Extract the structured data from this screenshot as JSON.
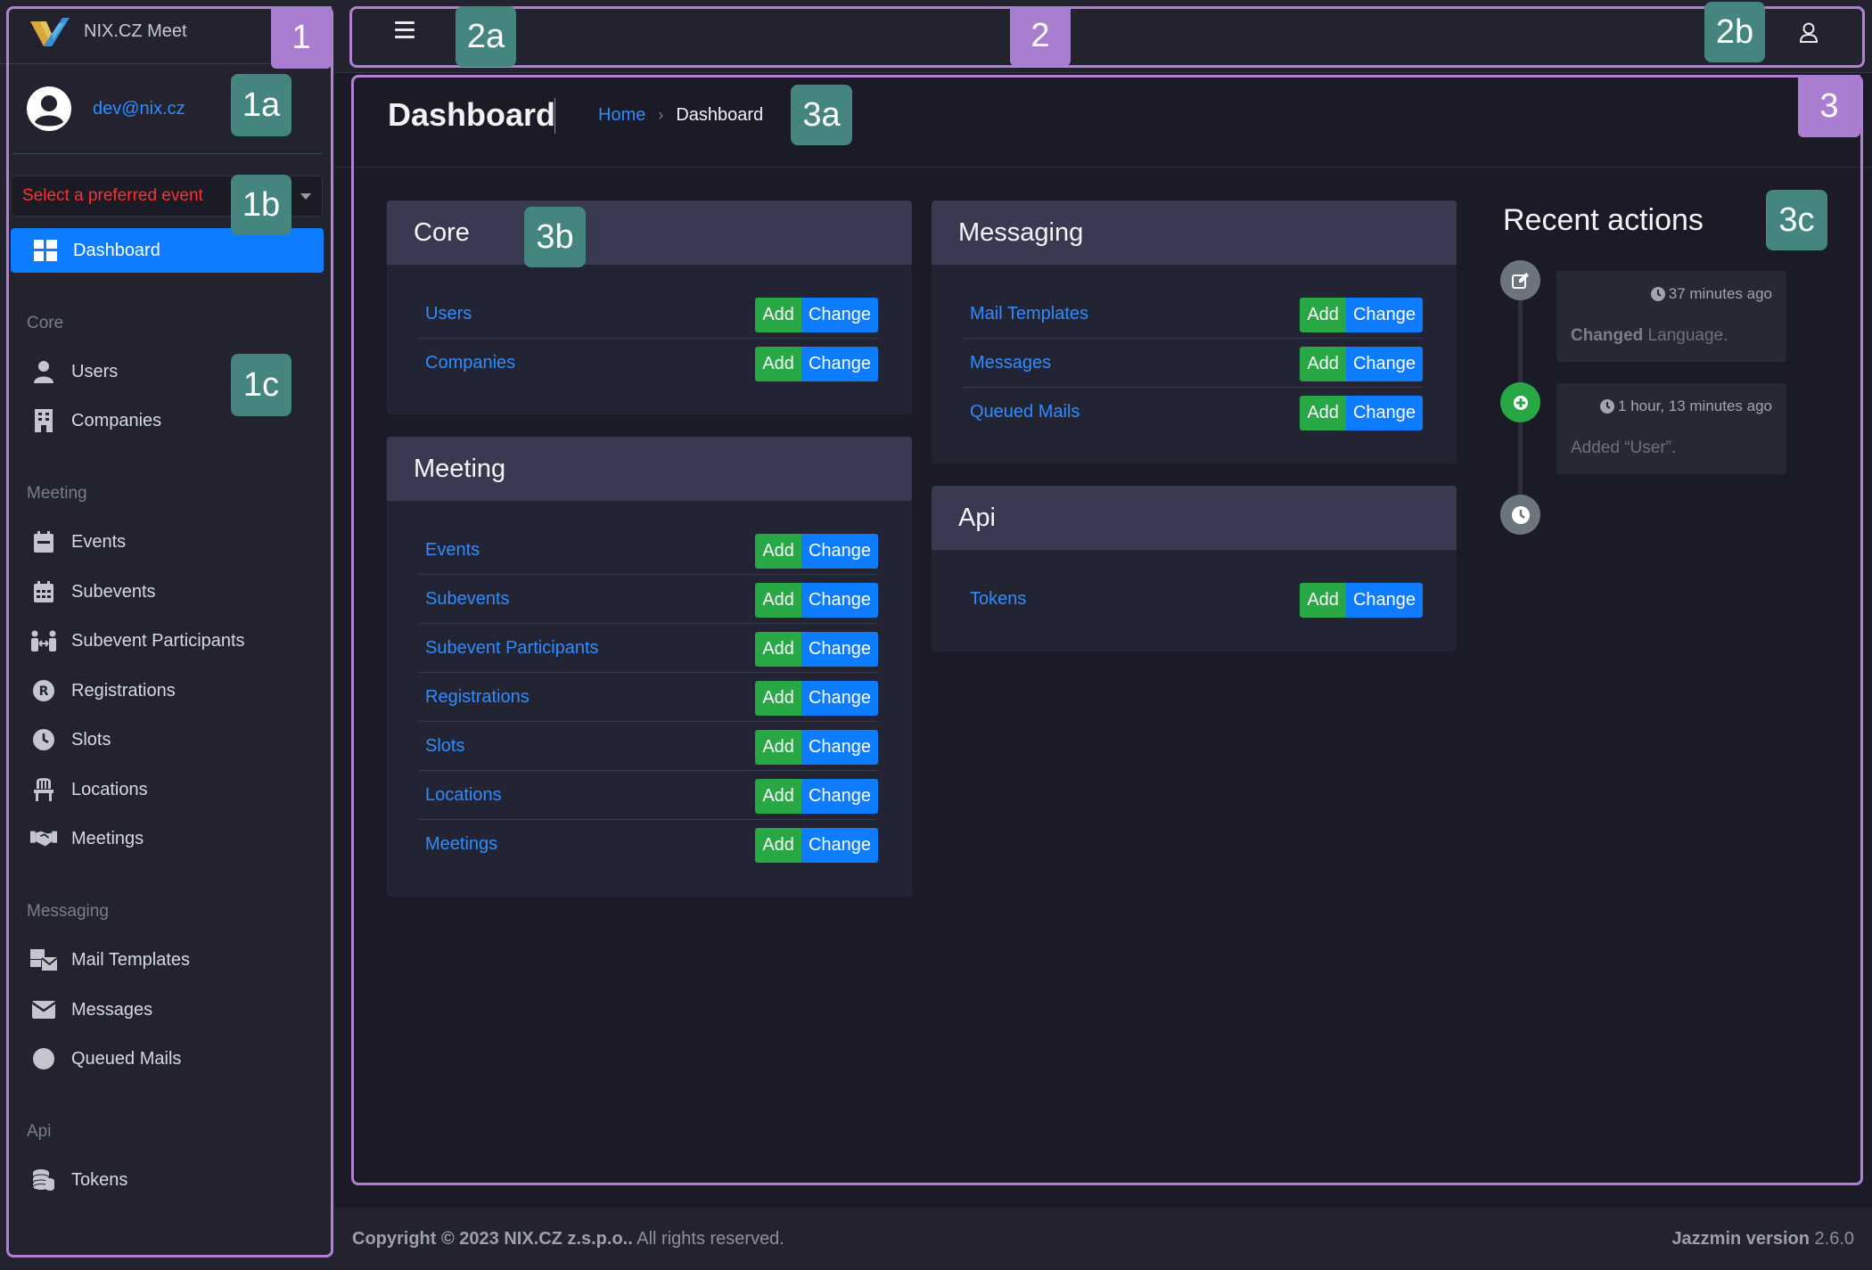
{
  "brand": {
    "name": "NIX.CZ Meet"
  },
  "user": {
    "email": "dev@nix.cz"
  },
  "event_select": {
    "placeholder": "Select a preferred event"
  },
  "sidebar": {
    "dashboard": "Dashboard",
    "sections": [
      {
        "header": "Core",
        "items": [
          {
            "label": "Users",
            "icon": "user-icon"
          },
          {
            "label": "Companies",
            "icon": "building-icon"
          }
        ]
      },
      {
        "header": "Meeting",
        "items": [
          {
            "label": "Events",
            "icon": "calendar-icon"
          },
          {
            "label": "Subevents",
            "icon": "calendar-grid-icon"
          },
          {
            "label": "Subevent Participants",
            "icon": "people-arrows-icon"
          },
          {
            "label": "Registrations",
            "icon": "registered-icon"
          },
          {
            "label": "Slots",
            "icon": "clock-icon"
          },
          {
            "label": "Locations",
            "icon": "chair-icon"
          },
          {
            "label": "Meetings",
            "icon": "handshake-icon"
          }
        ]
      },
      {
        "header": "Messaging",
        "items": [
          {
            "label": "Mail Templates",
            "icon": "mail-bulk-icon"
          },
          {
            "label": "Messages",
            "icon": "envelope-icon"
          },
          {
            "label": "Queued Mails",
            "icon": "circle-icon"
          }
        ]
      },
      {
        "header": "Api",
        "items": [
          {
            "label": "Tokens",
            "icon": "coins-icon"
          }
        ]
      }
    ]
  },
  "header": {
    "title": "Dashboard",
    "breadcrumb": {
      "home": "Home",
      "separator": "›",
      "current": "Dashboard"
    }
  },
  "buttons": {
    "add": "Add",
    "change": "Change"
  },
  "apps": {
    "core": {
      "title": "Core",
      "models": [
        "Users",
        "Companies"
      ]
    },
    "meeting": {
      "title": "Meeting",
      "models": [
        "Events",
        "Subevents",
        "Subevent Participants",
        "Registrations",
        "Slots",
        "Locations",
        "Meetings"
      ]
    },
    "messaging": {
      "title": "Messaging",
      "models": [
        "Mail Templates",
        "Messages",
        "Queued Mails"
      ]
    },
    "api": {
      "title": "Api",
      "models": [
        "Tokens"
      ]
    }
  },
  "recent": {
    "title": "Recent actions",
    "items": [
      {
        "time": "37 minutes ago",
        "action": "Changed",
        "object": "Language."
      },
      {
        "time": "1 hour, 13 minutes ago",
        "text": "Added “User”."
      }
    ]
  },
  "footer": {
    "copyright_bold": "Copyright © 2023 NIX.CZ z.s.p.o..",
    "copyright_rest": " All rights reserved.",
    "version_bold": "Jazzmin version",
    "version": " 2.6.0"
  },
  "annotations": [
    "1",
    "1a",
    "1b",
    "1c",
    "2",
    "2a",
    "2b",
    "3",
    "3a",
    "3b",
    "3c"
  ],
  "colors": {
    "accent": "#0d7cff",
    "add": "#27a844",
    "frame": "#b27fd4",
    "tag_teal": "#44857f"
  }
}
